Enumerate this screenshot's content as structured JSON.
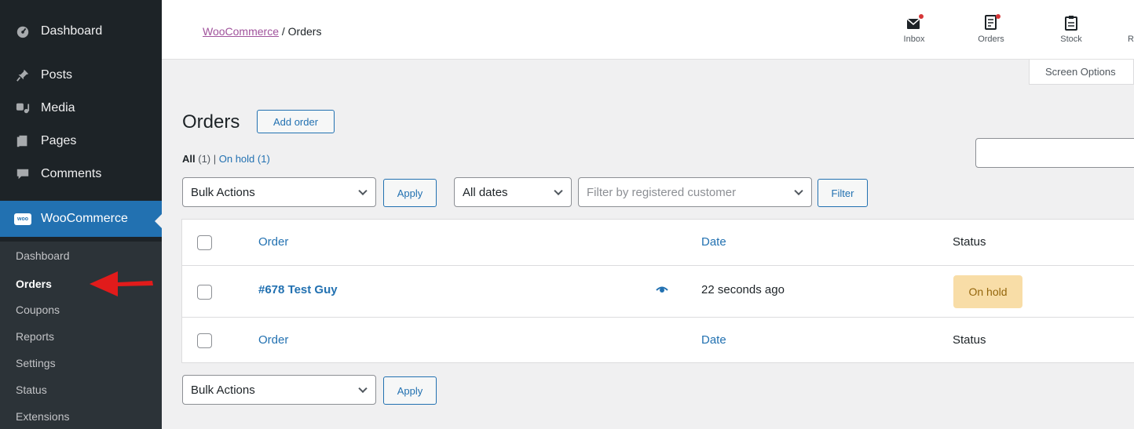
{
  "sidebar": {
    "items": [
      {
        "label": "Dashboard",
        "icon": "dashboard-icon"
      },
      {
        "label": "Posts",
        "icon": "pin-icon"
      },
      {
        "label": "Media",
        "icon": "media-icon"
      },
      {
        "label": "Pages",
        "icon": "pages-icon"
      },
      {
        "label": "Comments",
        "icon": "comment-icon"
      }
    ],
    "woocommerce": {
      "label": "WooCommerce",
      "badge": "woo"
    },
    "submenu": [
      {
        "label": "Dashboard"
      },
      {
        "label": "Orders",
        "current": true
      },
      {
        "label": "Coupons"
      },
      {
        "label": "Reports"
      },
      {
        "label": "Settings"
      },
      {
        "label": "Status"
      },
      {
        "label": "Extensions"
      }
    ]
  },
  "header": {
    "breadcrumb_link": "WooCommerce",
    "breadcrumb_sep": " / ",
    "breadcrumb_current": "Orders",
    "activity": [
      {
        "label": "Inbox",
        "icon": "inbox-icon"
      },
      {
        "label": "Orders",
        "icon": "orders-icon"
      },
      {
        "label": "Stock",
        "icon": "stock-icon"
      },
      {
        "label": "R",
        "icon": "reviews-icon"
      }
    ],
    "screen_options": "Screen Options"
  },
  "main": {
    "title": "Orders",
    "add_order": "Add order",
    "views": {
      "all_label": "All",
      "all_count": "(1)",
      "sep": " | ",
      "onhold_label": "On hold",
      "onhold_count": "(1)"
    },
    "bulk_actions": "Bulk Actions",
    "apply": "Apply",
    "dates": "All dates",
    "customer_placeholder": "Filter by registered customer",
    "filter": "Filter",
    "search_value": ""
  },
  "table": {
    "columns": {
      "order": "Order",
      "date": "Date",
      "status": "Status"
    },
    "rows": [
      {
        "order": "#678 Test Guy",
        "date": "22 seconds ago",
        "status": "On hold"
      }
    ]
  },
  "colors": {
    "sidebar_bg": "#1d2327",
    "accent": "#2271b1",
    "status_onhold_bg": "#f8dda7",
    "arrow": "#e11b1b"
  }
}
